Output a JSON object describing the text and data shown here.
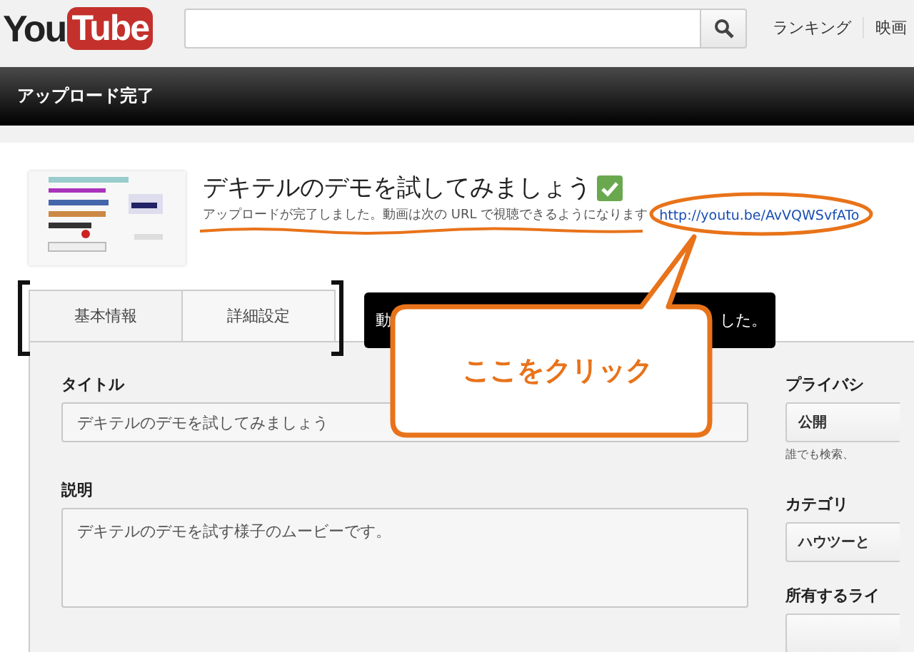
{
  "header": {
    "logo": {
      "word": "You",
      "badge": "Tube"
    },
    "nav_links": [
      "ランキング",
      "映画"
    ]
  },
  "banner": {
    "title": "アップロード完了"
  },
  "video": {
    "title": "デキテルのデモを試してみましょう",
    "processed": true,
    "message": "アップロードが完了しました。動画は次の URL で視聴できるようになります",
    "url": "http://youtu.be/AvVQWSvfATo"
  },
  "tabs": [
    {
      "label": "基本情報",
      "selected": true
    },
    {
      "label": "詳細設定",
      "selected": false
    }
  ],
  "tooltip": {
    "text_start": "動",
    "text_end": "した。"
  },
  "fields": [
    {
      "kind": "input",
      "label": "タイトル",
      "value": "デキテルのデモを試してみましょう"
    },
    {
      "kind": "textarea",
      "label": "説明",
      "value": "デキテルのデモを試す様子のムービーです。"
    }
  ],
  "sidebar": [
    {
      "label": "プライバシ",
      "value": "公開",
      "note": "誰でも検索、"
    },
    {
      "label": "カテゴリ",
      "value": "ハウツーと"
    },
    {
      "label": "所有するライ"
    }
  ],
  "annotation": {
    "callout": "ここをクリック"
  }
}
